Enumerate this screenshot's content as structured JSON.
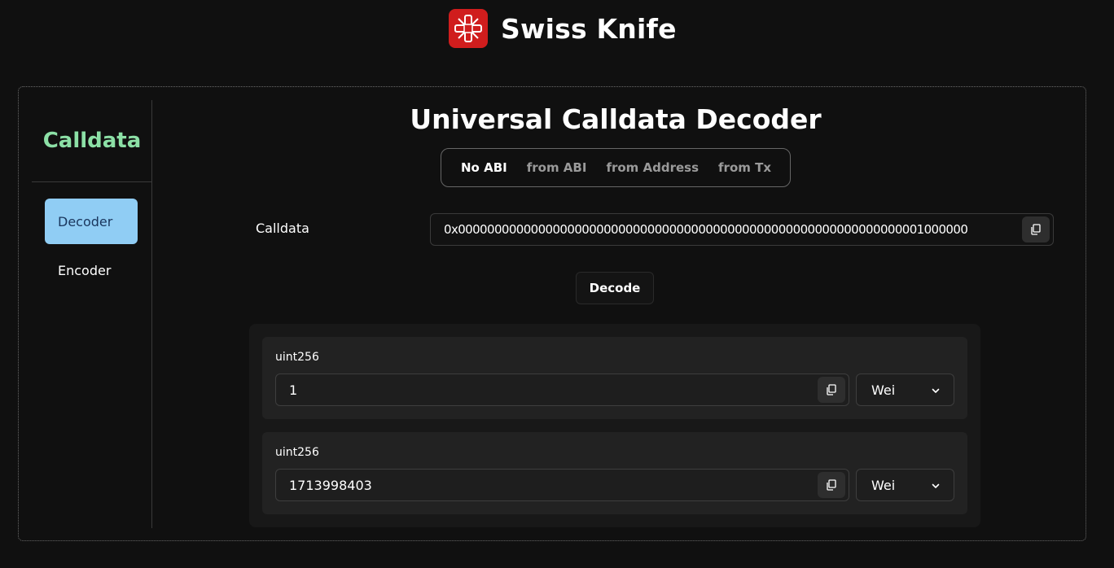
{
  "header": {
    "title": "Swiss Knife",
    "logo_icon": "swiss-knife-logo-icon"
  },
  "sidebar": {
    "title": "Calldata",
    "items": [
      {
        "label": "Decoder",
        "active": true
      },
      {
        "label": "Encoder",
        "active": false
      }
    ]
  },
  "main": {
    "title": "Universal Calldata Decoder",
    "tabs": [
      {
        "label": "No ABI",
        "active": true
      },
      {
        "label": "from ABI",
        "active": false
      },
      {
        "label": "from Address",
        "active": false
      },
      {
        "label": "from Tx",
        "active": false
      }
    ],
    "calldata_label": "Calldata",
    "calldata_value": "0x0000000000000000000000000000000000000000000000000000000000000001000000",
    "decode_label": "Decode"
  },
  "results": [
    {
      "type": "uint256",
      "value": "1",
      "unit": "Wei"
    },
    {
      "type": "uint256",
      "value": "1713998403",
      "unit": "Wei"
    }
  ],
  "colors": {
    "background": "#101010",
    "sidebar_title": "#8ce0a6",
    "active_nav": "#90cdf4",
    "logo": "#d01d1d"
  }
}
